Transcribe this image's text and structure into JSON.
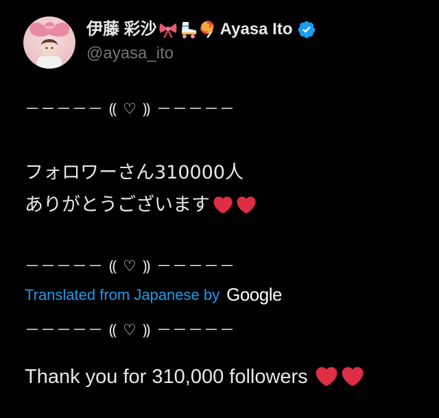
{
  "author": {
    "display_name": "伊藤 彩沙",
    "emojis": [
      "ribbon-emoji",
      "roller-skate-emoji",
      "lollipop-emoji"
    ],
    "latin_name": "Ayasa Ito",
    "verified": true,
    "handle": "@ayasa_ito"
  },
  "tweet": {
    "divider": "－－－－－ ⸨ ♡ ⸩ －－－－－",
    "original_lines": [
      "フォロワーさん310000人",
      "ありがとうございます"
    ],
    "translation": {
      "label": "Translated from Japanese by",
      "provider": "Google"
    },
    "translated_text": "Thank you for 310,000 followers"
  },
  "colors": {
    "background": "#000000",
    "text": "#e7e9ea",
    "handle": "#71767b",
    "link": "#1d9bf0",
    "heart": "#dd2e44",
    "verified": "#1d9bf0"
  }
}
